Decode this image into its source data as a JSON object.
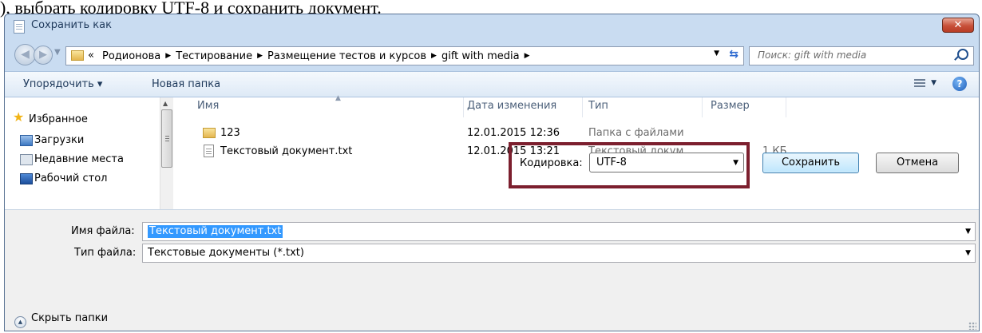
{
  "caption": "), выбрать кодировку UTF-8 и сохранить документ.",
  "window": {
    "title": "Сохранить как",
    "close_glyph": "✕"
  },
  "nav": {
    "back_glyph": "◀",
    "forward_glyph": "▶",
    "crumb_overflow": "«",
    "breadcrumbs": [
      "Родионова",
      "Тестирование",
      "Размещение тестов и курсов",
      "gift with media"
    ],
    "search_placeholder": "Поиск: gift with media"
  },
  "toolbar": {
    "organize": "Упорядочить ▾",
    "new_folder": "Новая папка",
    "help": "?"
  },
  "sidebar": {
    "items": [
      {
        "label": "Избранное",
        "icon": "star-icon"
      },
      {
        "label": "Загрузки",
        "icon": "downloads-icon"
      },
      {
        "label": "Недавние места",
        "icon": "recent-places-icon"
      },
      {
        "label": "Рабочий стол",
        "icon": "desktop-icon"
      }
    ]
  },
  "files": {
    "columns": {
      "name": "Имя",
      "date": "Дата изменения",
      "type": "Тип",
      "size": "Размер"
    },
    "rows": [
      {
        "name": "123",
        "date": "12.01.2015 12:36",
        "type": "Папка с файлами",
        "size": "",
        "icon": "folder-icon"
      },
      {
        "name": "Текстовый документ.txt",
        "date": "12.01.2015 13:21",
        "type": "Текстовый докум...",
        "size": "1 КБ",
        "icon": "text-file-icon"
      }
    ]
  },
  "form": {
    "filename_label": "Имя файла:",
    "filename_value": "Текстовый документ.txt",
    "filetype_label": "Тип файла:",
    "filetype_value": "Текстовые документы (*.txt)",
    "hide_folders": "Скрыть папки",
    "encoding_label": "Кодировка:",
    "encoding_value": "UTF-8",
    "save": "Сохранить",
    "cancel": "Отмена"
  },
  "colors": {
    "highlight_box": "#7c1f2e",
    "selection": "#3399ff",
    "window_frame": "#c9dcf1"
  }
}
